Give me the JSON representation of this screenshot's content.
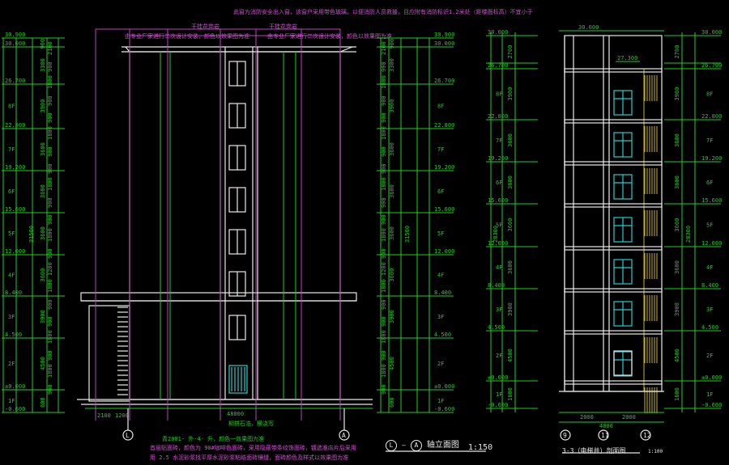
{
  "colors": {
    "background": "#000000",
    "dim": "#19d219",
    "outline": "#e8e8e8",
    "note": "#c040c0",
    "glass": "#20d0d0",
    "stair": "#c8b428"
  },
  "notes_top": "此窗为消防安全出入窗，该窗户采用带色玻璃，以便消防人员救援，且应附有消防标识1.2米处（距楼面标高）不宜小于",
  "notes_magenta": [
    "由专业厂家进行二次设计安装，颜色以效果图为准",
    "由专业厂家进行二次设计安装，颜色以效果图为准"
  ],
  "labels_top": [
    "干挂花岗岩",
    "干挂花岗岩"
  ],
  "bottom_notes": [
    "柳拼石浩，横浇写",
    "青2001- 外-4- 升，颜色一效果图为准",
    "首层贴面砖，颜色为 90#咖啡色面砖，采用隐蔽带条纹饰面砖，镀选准向片后采用",
    "用 2.5 水泥砂浆找平厚水泥砂浆粘结面砖镶缝，面砖颜色及样式以效果图为准"
  ],
  "elev": {
    "left_levels": [
      "30.900",
      "30.000",
      "26.700",
      "22.800",
      "19.200",
      "15.600",
      "12.000",
      "8.400",
      "4.500",
      "±0.000",
      "-0.600"
    ],
    "floors": [
      "8F",
      "7F",
      "6F",
      "5F",
      "4F",
      "3F",
      "2F",
      "1F"
    ],
    "seg_dims": [
      "900",
      "3300",
      "3900",
      "3600",
      "3600",
      "3600",
      "3600",
      "3900",
      "4500",
      "600"
    ],
    "sub_dims": [
      "2100",
      "900",
      "1800",
      "900",
      "900",
      "1800",
      "900",
      "900",
      "1800",
      "900",
      "900",
      "1800",
      "900",
      "1200",
      "1800",
      "900",
      "900",
      "1800",
      "900",
      "1800",
      "900"
    ],
    "total": "31500",
    "bottom_total": "48800",
    "bottom_dims": [
      "2100",
      "1200"
    ],
    "axis_left": "L",
    "axis_right": "A",
    "title_axes": [
      "L",
      "A"
    ],
    "title_text": "轴立面图",
    "scale": "1:150"
  },
  "section": {
    "levels": [
      "30.000",
      "27.300",
      "26.700",
      "22.800",
      "19.200",
      "15.600",
      "12.000",
      "8.400",
      "4.500",
      "±0.000",
      "-0.600"
    ],
    "floors": [
      "8F",
      "7F",
      "6F",
      "5F",
      "4F",
      "3F",
      "2F",
      "1F"
    ],
    "seg_dims": [
      "2700",
      "3900",
      "3600",
      "3600",
      "3600",
      "3600",
      "3900",
      "4500",
      "1600"
    ],
    "total": "28300",
    "top_dim": "30.000",
    "inner_level": "27.300",
    "base_dims": [
      "2000",
      "2000"
    ],
    "base_total": "4000",
    "axes": [
      "9",
      "11",
      "12"
    ],
    "title": "3-3（电梯井）剖面图",
    "scale": "1:100"
  }
}
